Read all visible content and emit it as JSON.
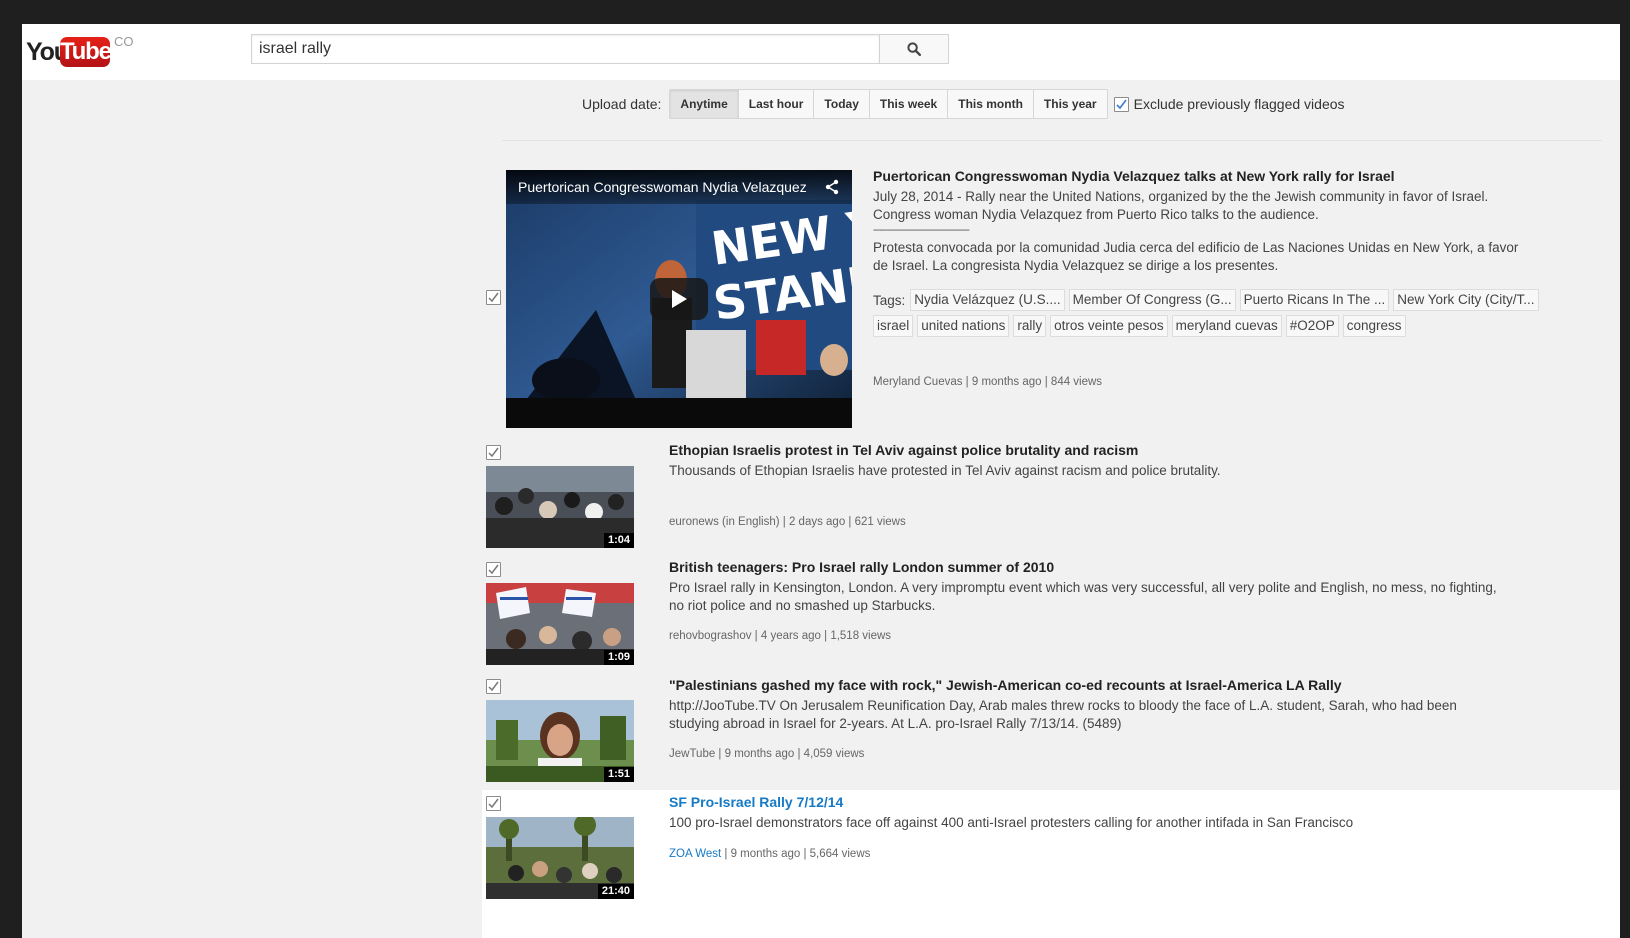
{
  "masthead": {
    "logo_you": "You",
    "logo_tube": "Tube",
    "logo_country": "CO",
    "search_value": "israel rally",
    "search_icon": "search-icon"
  },
  "filters": {
    "label": "Upload date:",
    "options": [
      "Anytime",
      "Last hour",
      "Today",
      "This week",
      "This month",
      "This year"
    ],
    "active": "Anytime",
    "exclude_label": "Exclude previously flagged videos",
    "exclude_checked": true
  },
  "results": [
    {
      "title": "Puertorican Congresswoman Nydia Velazquez talks at New York rally for Israel",
      "player_title": "Puertorican Congresswoman Nydia Velazquez",
      "desc_line1": "July 28, 2014 - Rally near the United Nations, organized by the the Jewish community in favor of Israel. Congress woman Nydia Velazquez from Puerto Rico talks to the audience.",
      "separator": "------------------------------------",
      "desc_line2": "Protesta convocada por la comunidad Judia cerca del edificio de Las Naciones Unidas en New York, a favor de Israel. La congresista Nydia Velazquez se dirige a los presentes.",
      "tags_label": "Tags:",
      "tags": [
        "Nydia Velázquez (U.S....",
        "Member Of Congress (G...",
        "Puerto Ricans In The ...",
        "New York City (City/T...",
        "israel",
        "united nations",
        "rally",
        "otros veinte pesos",
        "meryland cuevas",
        "#O2OP",
        "congress"
      ],
      "meta": "Meryland Cuevas | 9 months ago | 844 views",
      "checked": true
    },
    {
      "title": "Ethopian Israelis protest in Tel Aviv against police brutality and racism",
      "desc": "Thousands of Ethopian Israelis have protested in Tel Aviv against racism and police brutality.",
      "meta": "euronews (in English) | 2 days ago | 621 views",
      "duration": "1:04",
      "checked": true
    },
    {
      "title": "British teenagers: Pro Israel rally London summer of 2010",
      "desc": "Pro Israel rally in Kensington, London. A very impromptu event which was very successful, all very polite and English, no mess, no fighting, no riot police and no smashed up Starbucks.",
      "meta": "rehovbograshov | 4 years ago | 1,518 views",
      "duration": "1:09",
      "checked": true
    },
    {
      "title": "\"Palestinians gashed my face with rock,\" Jewish-American co-ed recounts at Israel-America LA Rally",
      "desc": "http://JooTube.TV On Jerusalem Reunification Day, Arab males threw rocks to bloody the face of L.A. student, Sarah, who had been studying abroad in Israel for 2-years. At L.A. pro-Israel Rally 7/13/14. (5489)",
      "meta": "JewTube | 9 months ago | 4,059 views",
      "duration": "1:51",
      "checked": true
    },
    {
      "title": "SF Pro-Israel Rally 7/12/14",
      "desc": "100 pro-Israel demonstrators face off against 400 anti-Israel protesters calling for another intifada in San Francisco",
      "meta_author": "ZOA West",
      "meta_rest": " | 9 months ago | 5,664 views",
      "duration": "21:40",
      "checked": true
    }
  ],
  "colors": {
    "brand_red": "#e62117",
    "link_blue": "#167ac6",
    "page_bg": "#f1f1f1"
  }
}
